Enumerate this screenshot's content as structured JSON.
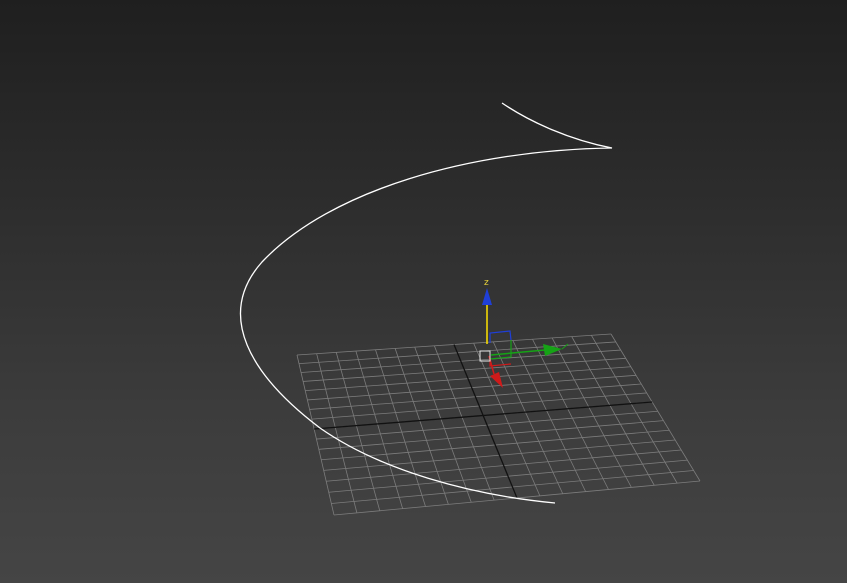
{
  "viewport": {
    "background_top": "#1f1f1f",
    "background_bottom": "#454545",
    "grid_color": "#7c7c7c",
    "grid_center_line_color": "#111111",
    "spline_color": "#ffffff",
    "grid_divisions": 16
  },
  "gizmo": {
    "z_axis_label": "z",
    "x_color": "#d01a1a",
    "y_color": "#16a316",
    "z_color": "#1f3fd8",
    "z_shaft_color": "#ffe200",
    "pivot_box_color": "#e6e6e6",
    "plane_xy_color": "#1f3fd8",
    "plane_yz_color": "#16a316",
    "plane_xz_color": "#d01a1a"
  }
}
